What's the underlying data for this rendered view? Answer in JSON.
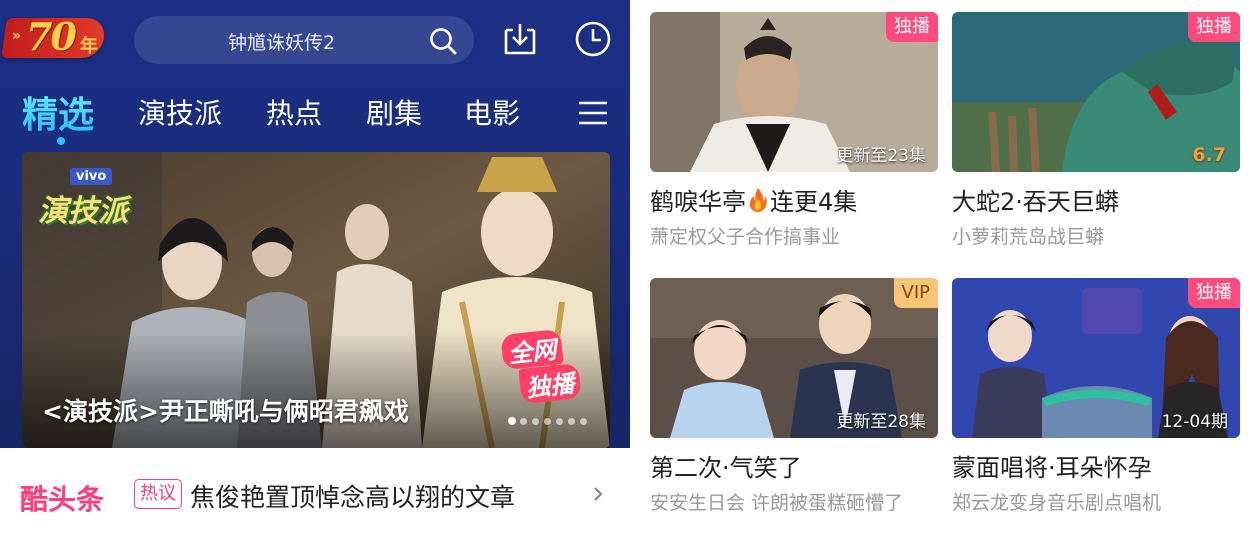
{
  "left": {
    "logo": {
      "arrows": "»",
      "number": "70",
      "suffix": "年"
    },
    "search": {
      "placeholder": "钟馗诛妖传2"
    },
    "tabs": [
      {
        "label": "精选",
        "active": true
      },
      {
        "label": "演技派"
      },
      {
        "label": "热点"
      },
      {
        "label": "剧集"
      },
      {
        "label": "电影"
      }
    ],
    "banner": {
      "brand": "vivo",
      "show_logo": "演技派",
      "badge_line1": "全网",
      "badge_line2": "独播",
      "title": "<演技派>尹正嘶吼与俩昭君飙戏",
      "dots_total": 7,
      "dots_active": 0
    },
    "hot": {
      "logo": "酷头条",
      "tag": "热议",
      "text": "焦俊艳置顶悼念高以翔的文章"
    }
  },
  "right": {
    "cards": [
      {
        "badge": "独播",
        "badge_style": "pink",
        "overlay": "更新至23集",
        "title_a": "鹤唳华亭",
        "title_b": "连更4集",
        "has_fire": true,
        "subtitle": "萧定权父子合作搞事业"
      },
      {
        "badge": "独播",
        "badge_style": "pink",
        "score": "6.7",
        "title_a": "大蛇2·吞天巨蟒",
        "subtitle": "小萝莉荒岛战巨蟒"
      },
      {
        "badge": "VIP",
        "badge_style": "vip",
        "overlay": "更新至28集",
        "title_a": "第二次·气笑了",
        "subtitle": "安安生日会 许朗被蛋糕砸懵了"
      },
      {
        "badge": "独播",
        "badge_style": "pink",
        "overlay": "12-04期",
        "title_a": "蒙面唱将·耳朵怀孕",
        "subtitle": "郑云龙变身音乐剧点唱机"
      }
    ]
  },
  "colors": {
    "header_bg": "#1b2f86",
    "active_tab": "#23b8ff",
    "accent_pink": "#ff3c7c",
    "vip_gold": "#f6c577"
  }
}
